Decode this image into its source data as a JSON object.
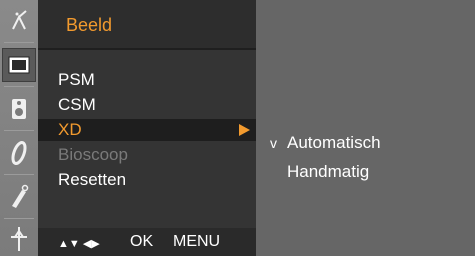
{
  "sidebar": {
    "icons": [
      {
        "name": "antenna-icon"
      },
      {
        "name": "picture-icon",
        "selected": true
      },
      {
        "name": "audio-icon"
      },
      {
        "name": "time-icon"
      },
      {
        "name": "special-icon"
      },
      {
        "name": "screen-icon"
      }
    ]
  },
  "menu": {
    "title": "Beeld",
    "items": [
      {
        "label": "PSM"
      },
      {
        "label": "CSM"
      },
      {
        "label": "XD",
        "active": true
      },
      {
        "label": "Bioscoop",
        "disabled": true
      },
      {
        "label": "Resetten"
      }
    ],
    "footer": {
      "nav": "▲▼ ◀▶",
      "ok": "OK",
      "menu": "MENU"
    }
  },
  "submenu": {
    "items": [
      {
        "label": "Automatisch",
        "check": "v",
        "selected": true
      },
      {
        "label": "Handmatig",
        "check": ""
      }
    ]
  },
  "colors": {
    "accent": "#f29a2e",
    "menu_bg": "#343434",
    "submenu_bg": "#666666"
  }
}
